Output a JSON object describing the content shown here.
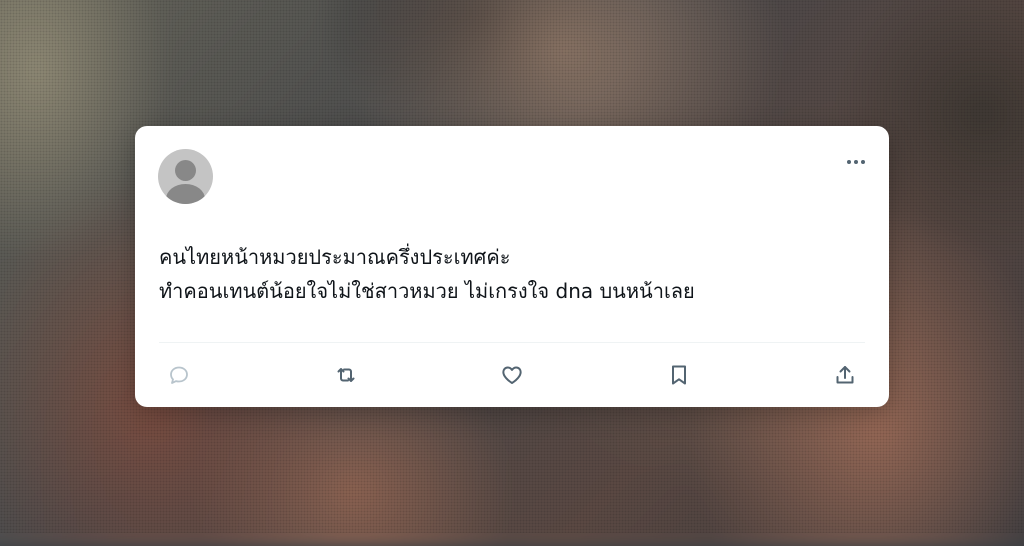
{
  "post": {
    "lines": [
      "คนไทยหน้าหมวยประมาณครึ่งประเทศค่ะ",
      "ทำคอนเทนต์น้อยใจไม่ใช่สาวหมวย ไม่เกรงใจ dna บนหน้าเลย"
    ]
  },
  "actions": [
    {
      "name": "reply",
      "icon": "reply-icon"
    },
    {
      "name": "repost",
      "icon": "repost-icon"
    },
    {
      "name": "like",
      "icon": "heart-icon"
    },
    {
      "name": "bookmark",
      "icon": "bookmark-icon"
    },
    {
      "name": "share",
      "icon": "share-icon"
    }
  ],
  "colors": {
    "icon": "#536471",
    "reply_icon": "#b8c4cc",
    "text": "#0f1419",
    "card": "#ffffff"
  }
}
